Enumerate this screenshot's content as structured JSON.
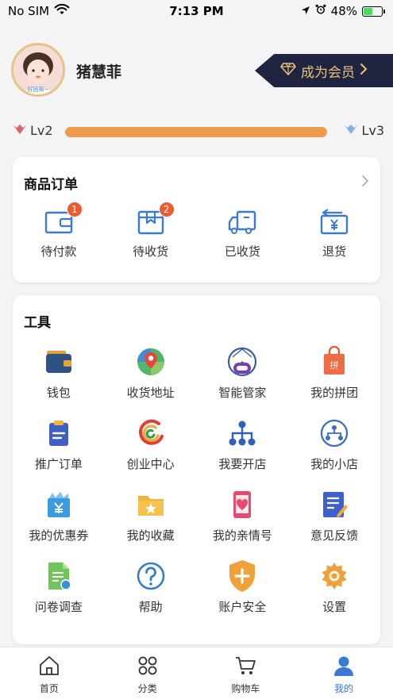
{
  "status_bar": {
    "carrier": "No SIM",
    "time": "7:13 PM",
    "battery": "48%"
  },
  "profile": {
    "username": "猪慧菲",
    "avatar_caption": "好困啊~",
    "vip_button": "成为会员"
  },
  "level": {
    "current": "Lv2",
    "next": "Lv3",
    "progress": 1.0
  },
  "orders": {
    "title": "商品订单",
    "items": [
      {
        "label": "待付款",
        "badge": "1",
        "icon": "wallet-card-icon"
      },
      {
        "label": "待收货",
        "badge": "2",
        "icon": "package-box-icon"
      },
      {
        "label": "已收货",
        "badge": "",
        "icon": "delivery-truck-icon"
      },
      {
        "label": "退货",
        "badge": "",
        "icon": "return-yen-icon"
      }
    ]
  },
  "tools": {
    "title": "工具",
    "items": [
      {
        "label": "钱包",
        "icon": "wallet-icon"
      },
      {
        "label": "收货地址",
        "icon": "map-pin-icon"
      },
      {
        "label": "智能管家",
        "icon": "robot-icon"
      },
      {
        "label": "我的拼团",
        "icon": "group-buy-bag-icon"
      },
      {
        "label": "推广订单",
        "icon": "clipboard-icon"
      },
      {
        "label": "创业中心",
        "icon": "startup-logo-icon"
      },
      {
        "label": "我要开店",
        "icon": "network-tree-icon"
      },
      {
        "label": "我的小店",
        "icon": "shop-network-icon"
      },
      {
        "label": "我的优惠券",
        "icon": "coupon-icon"
      },
      {
        "label": "我的收藏",
        "icon": "star-folder-icon"
      },
      {
        "label": "我的亲情号",
        "icon": "heart-phone-icon"
      },
      {
        "label": "意见反馈",
        "icon": "feedback-pen-icon"
      },
      {
        "label": "问卷调查",
        "icon": "survey-doc-icon"
      },
      {
        "label": "帮助",
        "icon": "help-question-icon"
      },
      {
        "label": "账户安全",
        "icon": "shield-plus-icon"
      },
      {
        "label": "设置",
        "icon": "gear-icon"
      }
    ]
  },
  "tabbar": {
    "items": [
      {
        "label": "首页",
        "icon": "home-icon",
        "active": false
      },
      {
        "label": "分类",
        "icon": "grid-icon",
        "active": false
      },
      {
        "label": "购物车",
        "icon": "cart-icon",
        "active": false
      },
      {
        "label": "我的",
        "icon": "user-icon",
        "active": true
      }
    ]
  },
  "colors": {
    "accent": "#3a7ad5",
    "vip_bg": "#1f2540",
    "vip_text": "#e8c07a",
    "level_bar": "#f09a4c",
    "badge": "#ee5b2e"
  }
}
